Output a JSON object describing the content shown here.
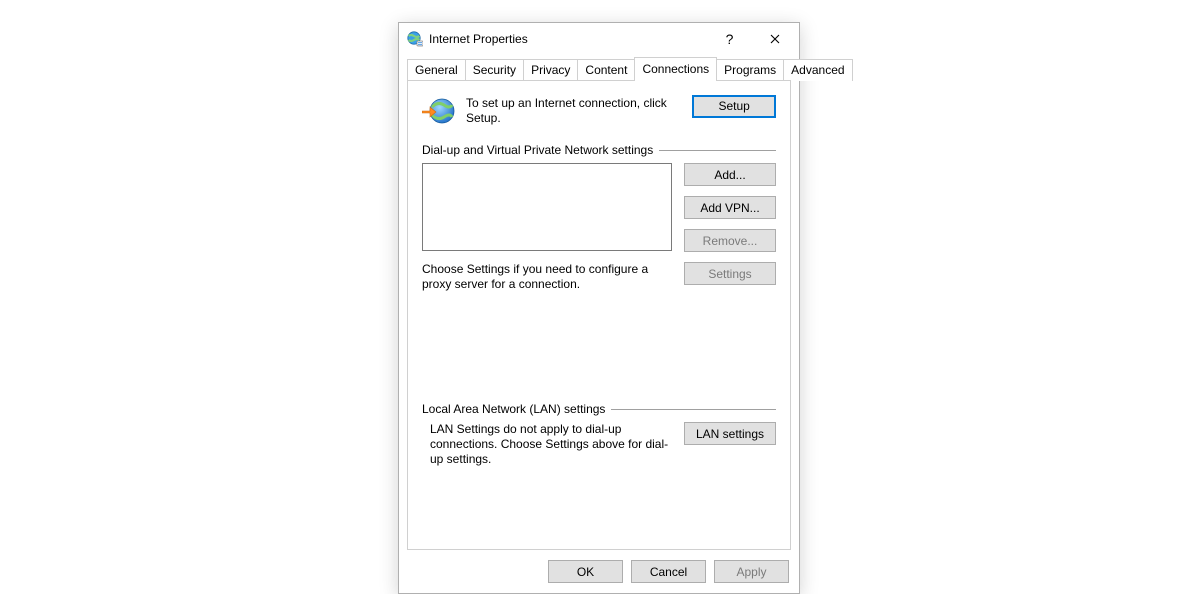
{
  "window": {
    "title": "Internet Properties"
  },
  "tabs": {
    "general": "General",
    "security": "Security",
    "privacy": "Privacy",
    "content": "Content",
    "connections": "Connections",
    "programs": "Programs",
    "advanced": "Advanced",
    "active": "connections"
  },
  "connections": {
    "intro": "To set up an Internet connection, click Setup.",
    "setup_btn": "Setup",
    "dialup_header": "Dial-up and Virtual Private Network settings",
    "add_btn": "Add...",
    "add_vpn_btn": "Add VPN...",
    "remove_btn": "Remove...",
    "settings_hint": "Choose Settings if you need to configure a proxy server for a connection.",
    "settings_btn": "Settings",
    "lan_header": "Local Area Network (LAN) settings",
    "lan_hint": "LAN Settings do not apply to dial-up connections. Choose Settings above for dial-up settings.",
    "lan_btn": "LAN settings"
  },
  "footer": {
    "ok": "OK",
    "cancel": "Cancel",
    "apply": "Apply"
  }
}
